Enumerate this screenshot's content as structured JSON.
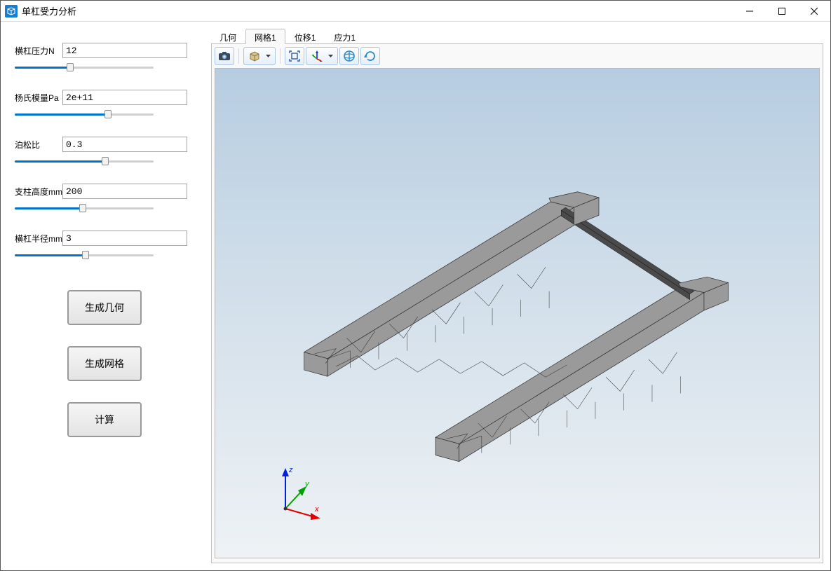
{
  "app": {
    "title": "单杠受力分析"
  },
  "params": [
    {
      "label": "横杠压力N",
      "value": "12",
      "slider_pct": 40
    },
    {
      "label": "杨氏模量Pa",
      "value": "2e+11",
      "slider_pct": 67
    },
    {
      "label": "泊松比",
      "value": "0.3",
      "slider_pct": 65
    },
    {
      "label": "支柱高度mm",
      "value": "200",
      "slider_pct": 49
    },
    {
      "label": "横杠半径mm",
      "value": "3",
      "slider_pct": 51
    }
  ],
  "buttons": {
    "gen_geom": "生成几何",
    "gen_mesh": "生成网格",
    "compute": "计算"
  },
  "tabs": [
    {
      "label": "几何",
      "active": false
    },
    {
      "label": "网格1",
      "active": true
    },
    {
      "label": "位移1",
      "active": false
    },
    {
      "label": "应力1",
      "active": false
    }
  ],
  "toolbar_icons": [
    "camera-icon",
    "cube-view-icon",
    "fit-view-icon",
    "axes-icon",
    "orbit-icon",
    "reset-icon"
  ],
  "axis_labels": {
    "x": "x",
    "y": "y",
    "z": "z"
  }
}
